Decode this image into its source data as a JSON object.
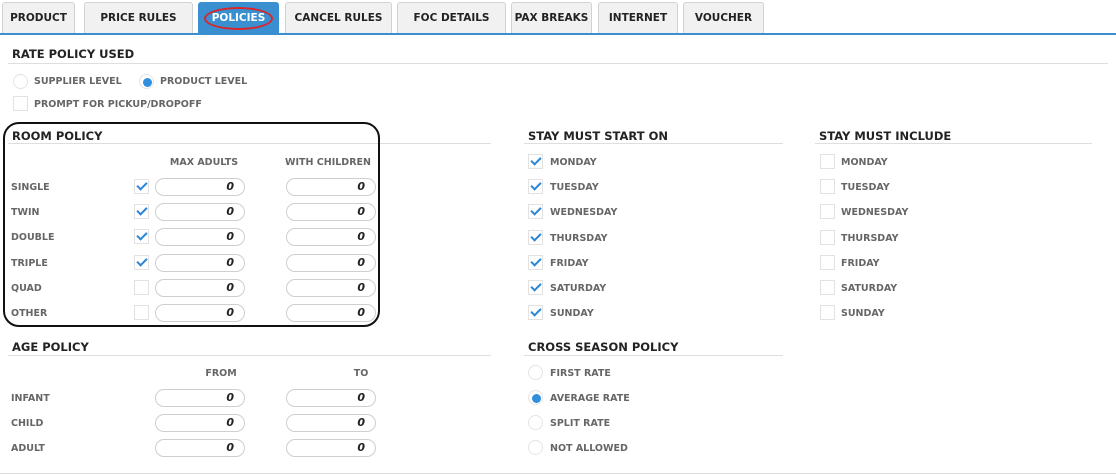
{
  "tabs": [
    {
      "label": "PRODUCT",
      "active": false
    },
    {
      "label": "PRICE RULES",
      "active": false
    },
    {
      "label": "POLICIES",
      "active": true
    },
    {
      "label": "CANCEL RULES",
      "active": false
    },
    {
      "label": "FOC DETAILS",
      "active": false
    },
    {
      "label": "PAX BREAKS",
      "active": false
    },
    {
      "label": "INTERNET",
      "active": false
    },
    {
      "label": "VOUCHER",
      "active": false
    }
  ],
  "rate_policy": {
    "title": "RATE POLICY USED",
    "supplier_level": "SUPPLIER LEVEL",
    "product_level": "PRODUCT LEVEL",
    "selected": "PRODUCT LEVEL",
    "prompt_pickup": "PROMPT FOR PICKUP/DROPOFF",
    "prompt_pickup_checked": false
  },
  "room_policy": {
    "title": "ROOM POLICY",
    "col_max_adults": "MAX ADULTS",
    "col_with_children": "WITH CHILDREN",
    "rows": [
      {
        "label": "SINGLE",
        "checked": true,
        "max_adults": "0",
        "with_children": "0"
      },
      {
        "label": "TWIN",
        "checked": true,
        "max_adults": "0",
        "with_children": "0"
      },
      {
        "label": "DOUBLE",
        "checked": true,
        "max_adults": "0",
        "with_children": "0"
      },
      {
        "label": "TRIPLE",
        "checked": true,
        "max_adults": "0",
        "with_children": "0"
      },
      {
        "label": "QUAD",
        "checked": false,
        "max_adults": "0",
        "with_children": "0"
      },
      {
        "label": "OTHER",
        "checked": false,
        "max_adults": "0",
        "with_children": "0"
      }
    ]
  },
  "stay_start": {
    "title": "STAY MUST START ON",
    "days": [
      {
        "label": "MONDAY",
        "checked": true
      },
      {
        "label": "TUESDAY",
        "checked": true
      },
      {
        "label": "WEDNESDAY",
        "checked": true
      },
      {
        "label": "THURSDAY",
        "checked": true
      },
      {
        "label": "FRIDAY",
        "checked": true
      },
      {
        "label": "SATURDAY",
        "checked": true
      },
      {
        "label": "SUNDAY",
        "checked": true
      }
    ]
  },
  "stay_include": {
    "title": "STAY MUST INCLUDE",
    "days": [
      {
        "label": "MONDAY",
        "checked": false
      },
      {
        "label": "TUESDAY",
        "checked": false
      },
      {
        "label": "WEDNESDAY",
        "checked": false
      },
      {
        "label": "THURSDAY",
        "checked": false
      },
      {
        "label": "FRIDAY",
        "checked": false
      },
      {
        "label": "SATURDAY",
        "checked": false
      },
      {
        "label": "SUNDAY",
        "checked": false
      }
    ]
  },
  "age_policy": {
    "title": "AGE POLICY",
    "col_from": "FROM",
    "col_to": "TO",
    "rows": [
      {
        "label": "INFANT",
        "from": "0",
        "to": "0"
      },
      {
        "label": "CHILD",
        "from": "0",
        "to": "0"
      },
      {
        "label": "ADULT",
        "from": "0",
        "to": "0"
      }
    ]
  },
  "cross_season": {
    "title": "CROSS SEASON POLICY",
    "options": [
      "FIRST RATE",
      "AVERAGE RATE",
      "SPLIT RATE",
      "NOT ALLOWED"
    ],
    "selected": "AVERAGE RATE"
  },
  "colors": {
    "accent": "#3a8fd0",
    "check": "#2a86d6",
    "annotation_oval": "#d8262b"
  }
}
